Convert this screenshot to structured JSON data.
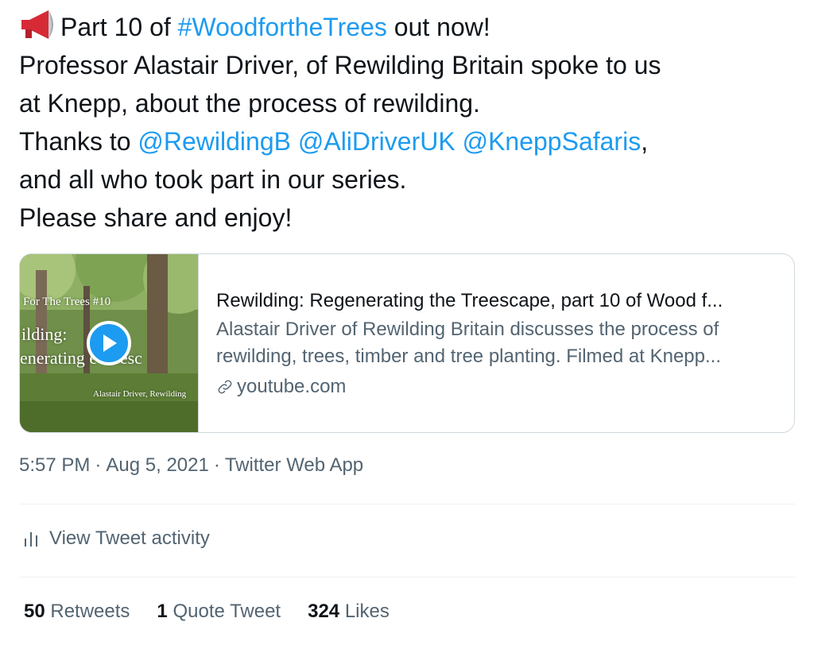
{
  "tweet": {
    "lines": [
      {
        "pre": "Part 10 of ",
        "hashtag": "#WoodfortheTrees",
        "post": " out now!"
      },
      "Professor Alastair Driver, of Rewilding Britain spoke to us",
      "at Knepp, about the process of rewilding.",
      {
        "pre": "Thanks to ",
        "mentions": [
          "@RewildingB",
          "@AliDriverUK",
          "@KneppSafaris"
        ],
        "post": ","
      },
      "and all who took part in our series.",
      "Please share and enjoy!"
    ],
    "emoji": "megaphone-icon"
  },
  "card": {
    "thumbnail": {
      "line1": "For The Trees #10",
      "line2": "ilding:",
      "line3": "enerating  e treesc",
      "line4": "Alastair Driver, Rewilding"
    },
    "title": "Rewilding: Regenerating the Treescape, part 10 of Wood f...",
    "description_lines": [
      "Alastair Driver of Rewilding Britain discusses the process of",
      "rewilding, trees, timber and tree planting. Filmed at Knepp..."
    ],
    "domain": "youtube.com"
  },
  "meta": {
    "time": "5:57 PM",
    "date": "Aug 5, 2021",
    "app": "Twitter Web App",
    "separator": "·"
  },
  "activity": {
    "label": "View Tweet activity"
  },
  "stats": [
    {
      "count": "50",
      "label": "Retweets"
    },
    {
      "count": "1",
      "label": "Quote Tweet"
    },
    {
      "count": "324",
      "label": "Likes"
    }
  ],
  "colors": {
    "link": "#1d9bf0",
    "text": "#0f1419",
    "secondary": "#536471",
    "border": "#cfd9de"
  }
}
